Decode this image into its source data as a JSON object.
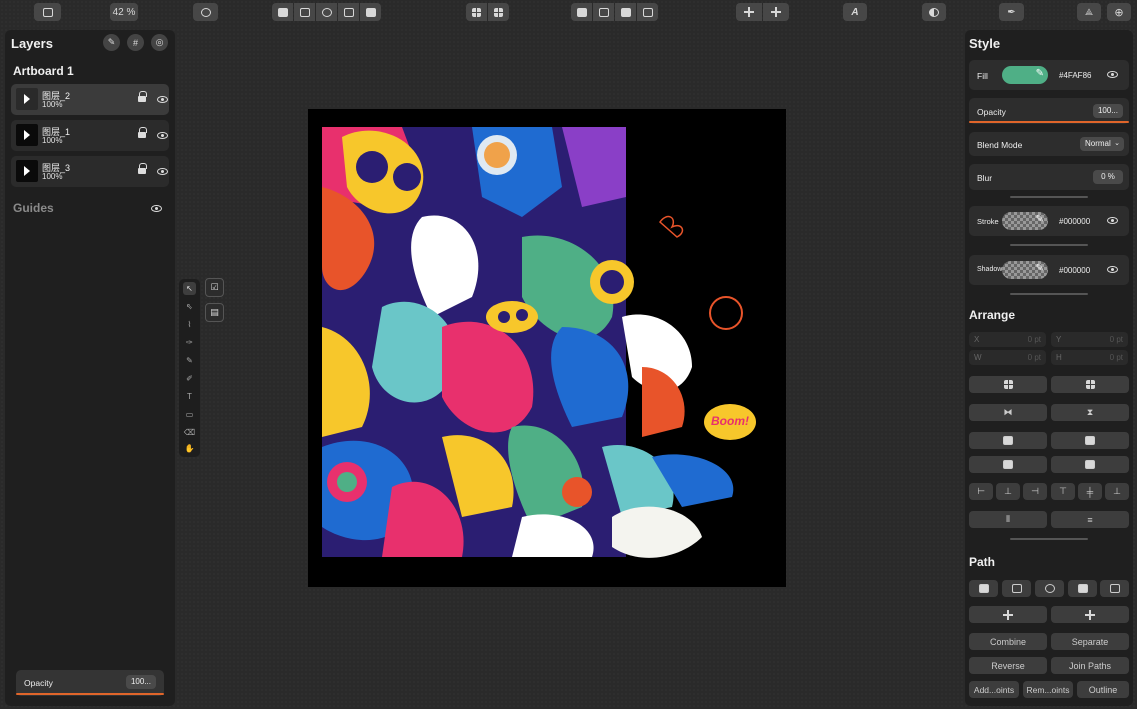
{
  "toolbar": {
    "zoom": "42 %"
  },
  "layers_panel": {
    "title": "Layers",
    "artboard": "Artboard 1",
    "layers": [
      {
        "name": "图层_2",
        "opacity": "100%"
      },
      {
        "name": "图层_1",
        "opacity": "100%"
      },
      {
        "name": "图层_3",
        "opacity": "100%"
      }
    ],
    "guides": "Guides",
    "opacity_label": "Opacity",
    "opacity_value": "100..."
  },
  "style_panel": {
    "title": "Style",
    "fill_label": "Fill",
    "fill_hex": "#4FAF86",
    "opacity_label": "Opacity",
    "opacity_value": "100...",
    "blend_label": "Blend Mode",
    "blend_value": "Normal",
    "blur_label": "Blur",
    "blur_value": "0 %",
    "stroke_label": "Stroke",
    "stroke_hex": "#000000",
    "shadow_label": "Shadow",
    "shadow_hex": "#000000"
  },
  "arrange_panel": {
    "title": "Arrange",
    "x_label": "X",
    "x_value": "0 pt",
    "y_label": "Y",
    "y_value": "0 pt",
    "w_label": "W",
    "w_value": "0 pt",
    "h_label": "H",
    "h_value": "0 pt"
  },
  "path_panel": {
    "title": "Path",
    "combine": "Combine",
    "separate": "Separate",
    "reverse": "Reverse",
    "join_paths": "Join Paths",
    "add_points": "Add...oints",
    "remove_points": "Rem...oints",
    "outline": "Outline"
  },
  "colors": {
    "fill": "#4FAF86",
    "accent": "#E0652A",
    "panel": "#1F1F1F"
  },
  "artwork": {
    "speech_bubble": "Boom!"
  }
}
